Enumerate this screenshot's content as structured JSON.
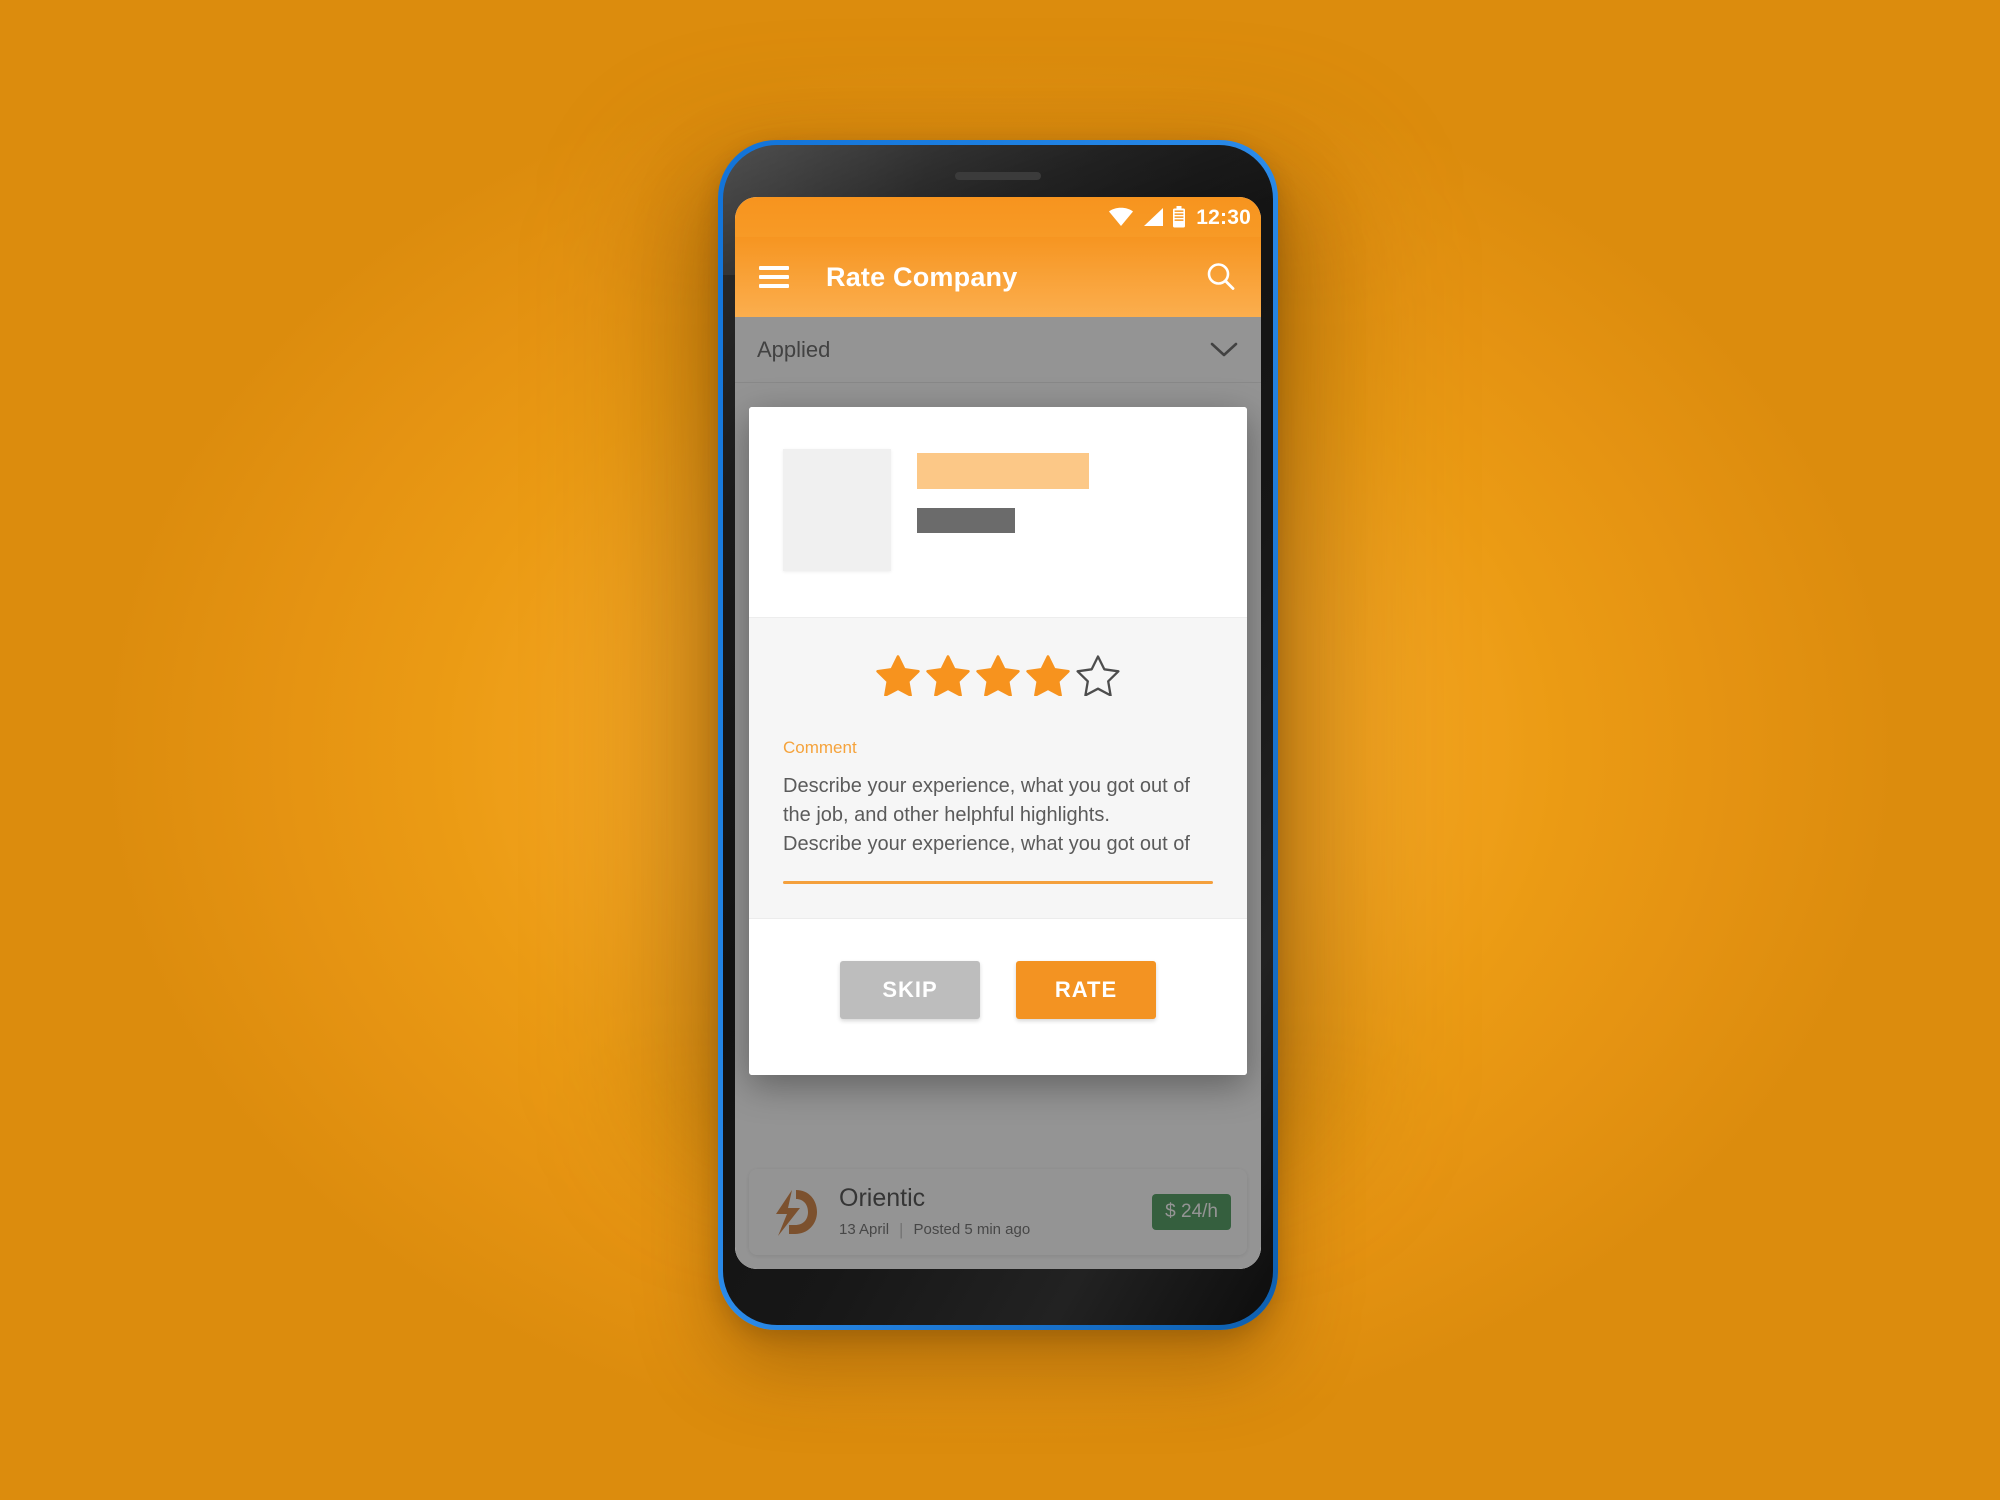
{
  "theme": {
    "background_color": "#f5a623",
    "phone_frame_color": "#1d7fe0",
    "bezel_color": "#161616",
    "accent_orange": "#f39322",
    "app_bar_orange": "#f9a33a",
    "placeholder_orange": "#fcc887",
    "placeholder_gray": "#6b6b6b",
    "scrim_color": "rgba(60,60,60,0.55)",
    "rate_badge_green": "#2e8b42",
    "skip_button_gray": "#bdbdbd"
  },
  "status_bar": {
    "time": "12:30",
    "icons": [
      "wifi-icon",
      "signal-icon",
      "battery-icon"
    ]
  },
  "app_bar": {
    "menu_icon": "hamburger-menu-icon",
    "title": "Rate Company",
    "search_icon": "search-icon"
  },
  "filter": {
    "label": "Applied",
    "chevron_icon": "chevron-down-icon"
  },
  "modal": {
    "placeholder_image": "image-placeholder",
    "placeholder_bar_primary": "title-placeholder-bar",
    "placeholder_bar_secondary": "subtitle-placeholder-bar",
    "rating": {
      "value": 4,
      "max": 5,
      "filled_icon": "star-filled-icon",
      "empty_icon": "star-outline-icon"
    },
    "comment": {
      "label": "Comment",
      "line1": "Describe your experience, what you got out of",
      "line2": "the job, and other helphful highlights.",
      "line3": "Describe your experience, what you got out of"
    },
    "actions": {
      "skip_label": "SKIP",
      "rate_label": "RATE"
    }
  },
  "job_card": {
    "logo_icon": "orientic-logo-icon",
    "company": "Orientic",
    "date": "13 April",
    "separator": "|",
    "posted": "Posted 5 min ago",
    "rate": "$ 24/h"
  }
}
